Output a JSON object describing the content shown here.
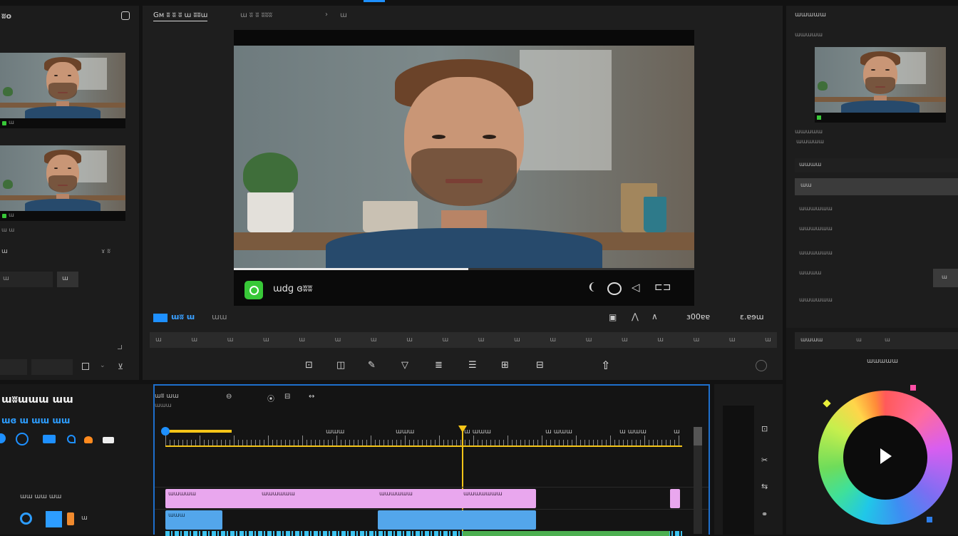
{
  "colors": {
    "accent_blue": "#1e90ff",
    "playhead_yellow": "#f5c518",
    "clip_pink": "#e9a7ee",
    "clip_blue": "#53a6eb",
    "clip_cyan": "#3cc3ef",
    "clip_green": "#4caf50",
    "play_green": "#38c838"
  },
  "media_panel": {
    "title": "ʬo",
    "clip1_label": "ɯ",
    "clip2_label": "ɯ",
    "meta_text": "ɯ ɯ",
    "section_label": "ɯ",
    "section_meta": "ɤ ʬ",
    "value_box": "ɯ",
    "value_button": "ɯ"
  },
  "viewer": {
    "tab_active": "Gᴍ ʬ ʬ ʬ ɯ ʬʬɯ",
    "tab_2": "ɯ ʬ ʬ ʬʬʬ",
    "tab_3": "ɯ",
    "overlay_title": "ɯdɡ ɞʬʬ",
    "playback_progress": 0.51,
    "timecode_left": "ɯʬ ɯ",
    "timecode_left_2": "ɯɯ",
    "timecode_right": "ɜ00ɐɐ",
    "timecode_right_2": "ɛ.ɐɘɯ"
  },
  "toolbar_labels": [
    "ɯ",
    "ɯ",
    "ɯ",
    "ɯ",
    "ɯ",
    "ɯ",
    "ɯ",
    "ɯ",
    "ɯ",
    "ɯ",
    "ɯ",
    "ɯ",
    "ɯ",
    "ɯ",
    "ɯ",
    "ɯ",
    "ɯ",
    "ɯ"
  ],
  "timeline": {
    "title": "ɯʬɯɯɯ ɯɯ",
    "subtitle": "ɯɞ ɯ ɯɯ ɯɯ",
    "header_a": "ɯʬ ɯɯ",
    "header_b": "ɯɯɯ",
    "ruler_labels": [
      "ɯɯɯ",
      "ɯɯɯ",
      "ɯ ɯɯɯ",
      "ɯ ɯɯɯ",
      "ɯ ɯɯɯ",
      "ɯ"
    ],
    "track_labels": [
      "ɯɯ ɯɯ ɯɯ",
      "ɯ",
      "ɯ"
    ],
    "clip_labels": [
      "ɯɯɯɯɯ",
      "ɯɯɯɯɯɯ",
      "ɯɯɯɯɯɯ",
      "ɯɯɯɯɯɯɯ",
      "ɯɯɯ"
    ]
  },
  "inspector": {
    "title": "ɯɯɯɯɯ",
    "subtitle": "ɯɯɯɯɯ",
    "meta": "ɯɯɯɯɯ",
    "meta_2": "ɯɯɯɯɯ",
    "section_header": "ɯɯɯɯ",
    "highlight_row": "ɯɯ",
    "rows": [
      "ɯɯɯɯɯɯ",
      "ɯɯɯɯɯɯ",
      "ɯɯɯɯɯɯ",
      "ɯɯɯɯ",
      "ɯɯɯɯɯɯ"
    ],
    "action_button": "ɯ",
    "tab_a": "ɯɯɯɯ",
    "tab_b": "ɯ",
    "tab_c": "ɯ",
    "color_title": "ɯɯɯɯɯ"
  },
  "icons": [
    "chat-icon",
    "play-icon",
    "camera-icon",
    "speaker-icon",
    "fullscreen-icon",
    "crop-icon",
    "rotate-icon",
    "lasso-icon",
    "effects-icon",
    "align-icon",
    "frame-icon",
    "export-icon",
    "share-icon",
    "undo-icon",
    "color-wheel"
  ]
}
